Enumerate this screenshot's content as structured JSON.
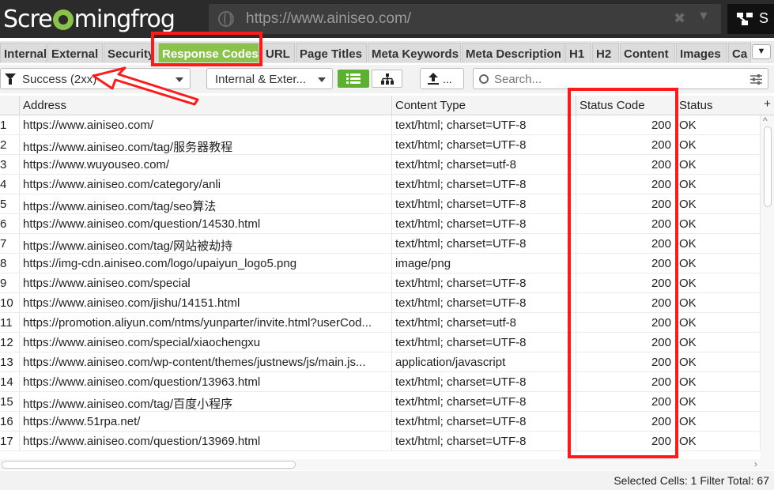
{
  "app": {
    "logo_text_a": "Scre",
    "logo_text_b": "mingfrog"
  },
  "urlbar": {
    "url": "https://www.ainiseo.com/",
    "clear_glyph": "✖",
    "drop_glyph": "▼",
    "spider_label": "S"
  },
  "tabs": [
    {
      "label": "Internal",
      "active": false
    },
    {
      "label": "External",
      "active": false
    },
    {
      "label": "Security",
      "active": false
    },
    {
      "label": "Response Codes",
      "active": true
    },
    {
      "label": "URL",
      "active": false
    },
    {
      "label": "Page Titles",
      "active": false
    },
    {
      "label": "Meta Keywords",
      "active": false
    },
    {
      "label": "Meta Description",
      "active": false
    },
    {
      "label": "H1",
      "active": false
    },
    {
      "label": "H2",
      "active": false
    },
    {
      "label": "Content",
      "active": false
    },
    {
      "label": "Images",
      "active": false
    },
    {
      "label": "Ca",
      "active": false
    }
  ],
  "tabs_more_glyph": "▼",
  "toolbar": {
    "filter_value": "Success (2xx)",
    "scope_value": "Internal & Exter...",
    "export_label": "...",
    "search_placeholder": "Search..."
  },
  "table": {
    "columns": [
      "Address",
      "Content Type",
      "Status Code",
      "Status"
    ],
    "add_column_glyph": "+",
    "rows": [
      {
        "n": "1",
        "address": "https://www.ainiseo.com/",
        "content_type": "text/html; charset=UTF-8",
        "code": "200",
        "status": "OK"
      },
      {
        "n": "2",
        "address": "https://www.ainiseo.com/tag/服务器教程",
        "content_type": "text/html; charset=UTF-8",
        "code": "200",
        "status": "OK"
      },
      {
        "n": "3",
        "address": "https://www.wuyouseo.com/",
        "content_type": "text/html; charset=utf-8",
        "code": "200",
        "status": "OK"
      },
      {
        "n": "4",
        "address": "https://www.ainiseo.com/category/anli",
        "content_type": "text/html; charset=UTF-8",
        "code": "200",
        "status": "OK"
      },
      {
        "n": "5",
        "address": "https://www.ainiseo.com/tag/seo算法",
        "content_type": "text/html; charset=UTF-8",
        "code": "200",
        "status": "OK"
      },
      {
        "n": "6",
        "address": "https://www.ainiseo.com/question/14530.html",
        "content_type": "text/html; charset=UTF-8",
        "code": "200",
        "status": "OK"
      },
      {
        "n": "7",
        "address": "https://www.ainiseo.com/tag/网站被劫持",
        "content_type": "text/html; charset=UTF-8",
        "code": "200",
        "status": "OK"
      },
      {
        "n": "8",
        "address": "https://img-cdn.ainiseo.com/logo/upaiyun_logo5.png",
        "content_type": "image/png",
        "code": "200",
        "status": "OK"
      },
      {
        "n": "9",
        "address": "https://www.ainiseo.com/special",
        "content_type": "text/html; charset=UTF-8",
        "code": "200",
        "status": "OK"
      },
      {
        "n": "10",
        "address": "https://www.ainiseo.com/jishu/14151.html",
        "content_type": "text/html; charset=UTF-8",
        "code": "200",
        "status": "OK"
      },
      {
        "n": "11",
        "address": "https://promotion.aliyun.com/ntms/yunparter/invite.html?userCod...",
        "content_type": "text/html; charset=utf-8",
        "code": "200",
        "status": "OK"
      },
      {
        "n": "12",
        "address": "https://www.ainiseo.com/special/xiaochengxu",
        "content_type": "text/html; charset=UTF-8",
        "code": "200",
        "status": "OK"
      },
      {
        "n": "13",
        "address": "https://www.ainiseo.com/wp-content/themes/justnews/js/main.js...",
        "content_type": "application/javascript",
        "code": "200",
        "status": "OK"
      },
      {
        "n": "14",
        "address": "https://www.ainiseo.com/question/13963.html",
        "content_type": "text/html; charset=UTF-8",
        "code": "200",
        "status": "OK"
      },
      {
        "n": "15",
        "address": "https://www.ainiseo.com/tag/百度小程序",
        "content_type": "text/html; charset=UTF-8",
        "code": "200",
        "status": "OK"
      },
      {
        "n": "16",
        "address": "https://www.51rpa.net/",
        "content_type": "text/html; charset=UTF-8",
        "code": "200",
        "status": "OK"
      },
      {
        "n": "17",
        "address": "https://www.ainiseo.com/question/13969.html",
        "content_type": "text/html; charset=UTF-8",
        "code": "200",
        "status": "OK"
      }
    ]
  },
  "scroll": {
    "up_glyph": "^",
    "right_glyph": "›"
  },
  "statusbar": {
    "selected_label": "Selected Cells:",
    "selected_value": "1",
    "filter_label": "Filter Total:",
    "filter_value": "67"
  },
  "colors": {
    "accent": "#8bc34a",
    "highlight": "#ff1a1a"
  }
}
